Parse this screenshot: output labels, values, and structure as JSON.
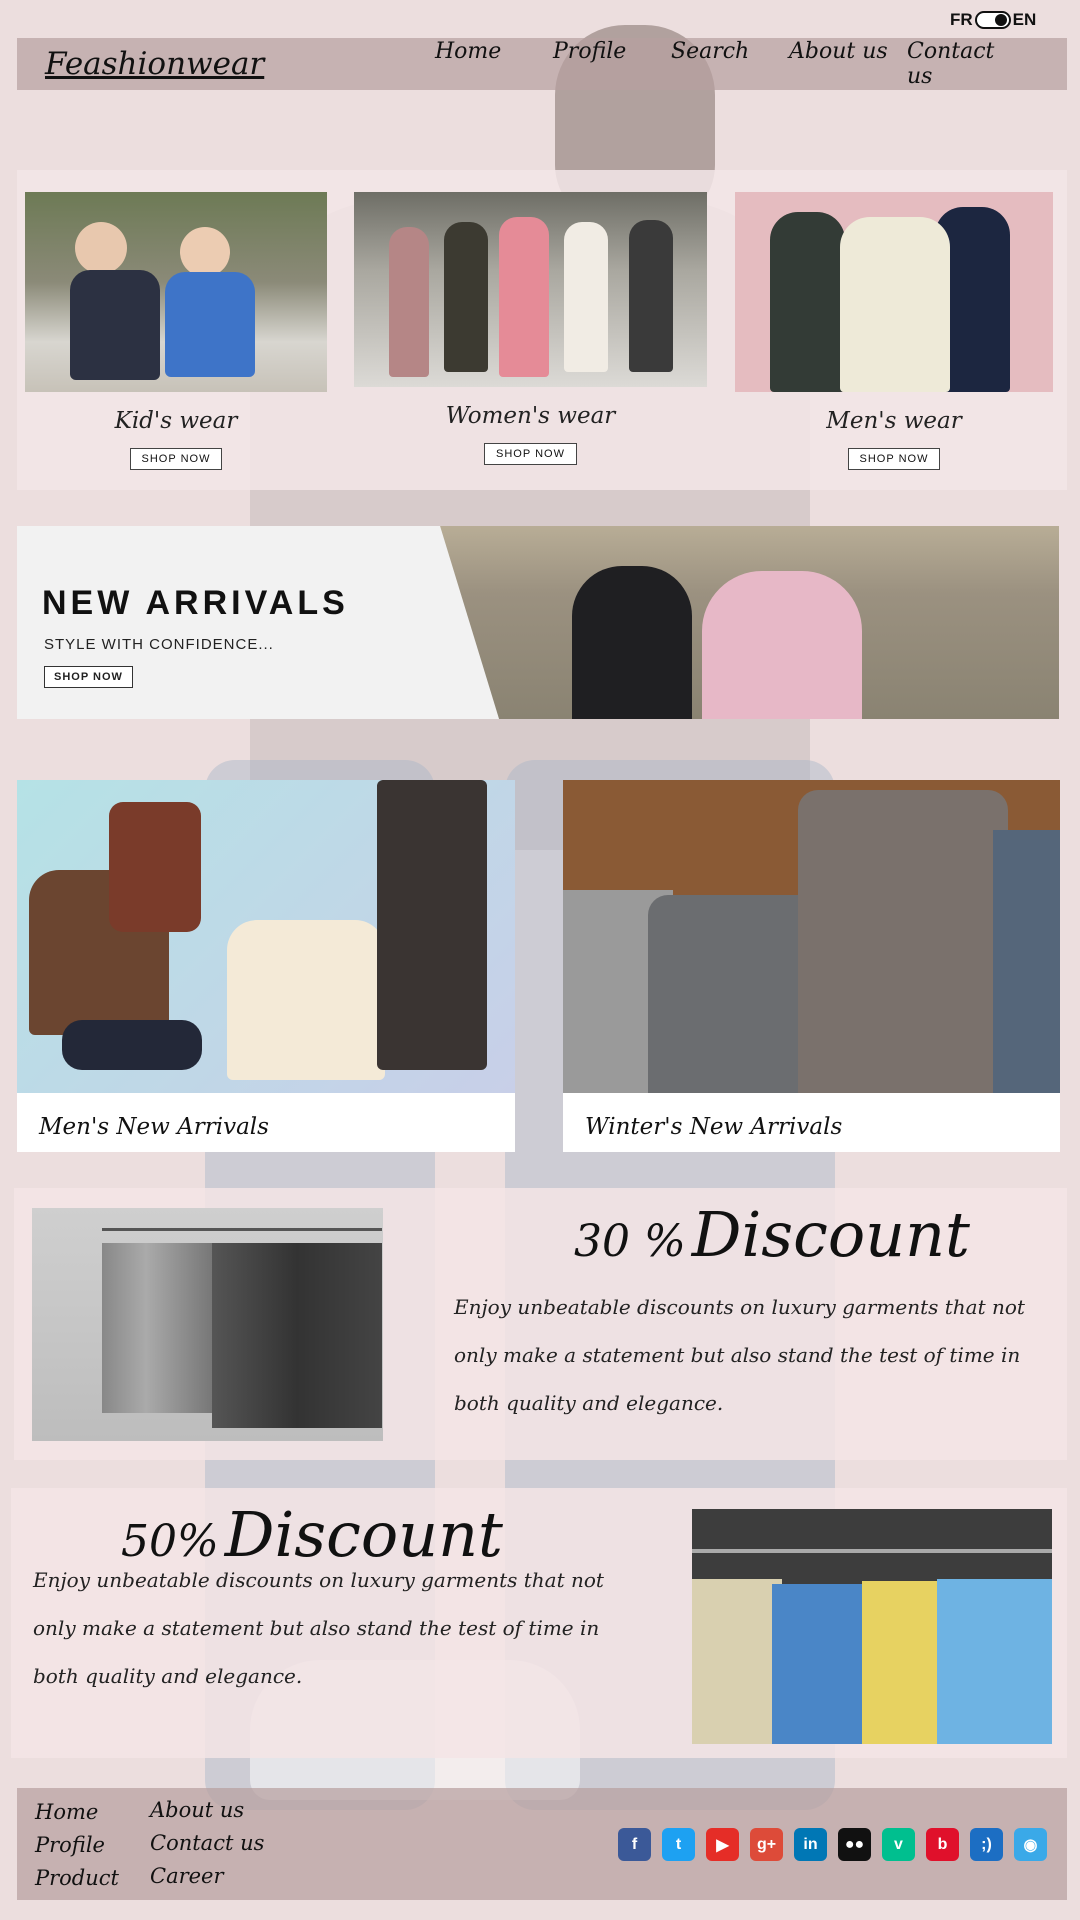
{
  "lang_toggle": {
    "left": "FR",
    "right": "EN"
  },
  "header": {
    "logo": "Feashionwear",
    "nav": [
      "Home",
      "Profile",
      "Search",
      "About us",
      "Contact us"
    ]
  },
  "categories": [
    {
      "title": "Kid's wear",
      "button": "SHOP NOW"
    },
    {
      "title": "Women's wear",
      "button": "SHOP NOW"
    },
    {
      "title": "Men's wear",
      "button": "SHOP NOW"
    }
  ],
  "banner": {
    "title": "NEW ARRIVALS",
    "subtitle": "STYLE WITH CONFIDENCE...",
    "button": "SHOP NOW"
  },
  "arrivals": [
    {
      "caption": "Men's New Arrivals"
    },
    {
      "caption": "Winter's New Arrivals"
    }
  ],
  "discount30": {
    "percent": "30 %",
    "word": "Discount",
    "text": "Enjoy unbeatable discounts on luxury garments that not only make a statement but also stand the test of time in both quality and elegance."
  },
  "discount50": {
    "percent": "50%",
    "word": "Discount",
    "text": "Enjoy unbeatable discounts on luxury garments that not only make a statement but also stand the test of time in both quality and elegance."
  },
  "footer": {
    "col1": [
      "Home",
      "Profile",
      "Product"
    ],
    "col2": [
      "About us",
      "Contact us",
      "Career"
    ],
    "social": [
      {
        "name": "facebook-icon",
        "glyph": "f",
        "color": "#3b5998"
      },
      {
        "name": "twitter-icon",
        "glyph": "t",
        "color": "#1da1f2"
      },
      {
        "name": "youtube-icon",
        "glyph": "▶",
        "color": "#e52d27"
      },
      {
        "name": "google-plus-icon",
        "glyph": "g+",
        "color": "#dd4b39"
      },
      {
        "name": "linkedin-icon",
        "glyph": "in",
        "color": "#0077b5"
      },
      {
        "name": "myspace-icon",
        "glyph": "●●",
        "color": "#111111"
      },
      {
        "name": "vine-icon",
        "glyph": "v",
        "color": "#00bf8f"
      },
      {
        "name": "behance-icon",
        "glyph": "b",
        "color": "#e0102b"
      },
      {
        "name": "rss-icon",
        "glyph": ";)",
        "color": "#1c6ec3"
      },
      {
        "name": "notification-icon",
        "glyph": "◉",
        "color": "#3aa9e8"
      }
    ]
  }
}
